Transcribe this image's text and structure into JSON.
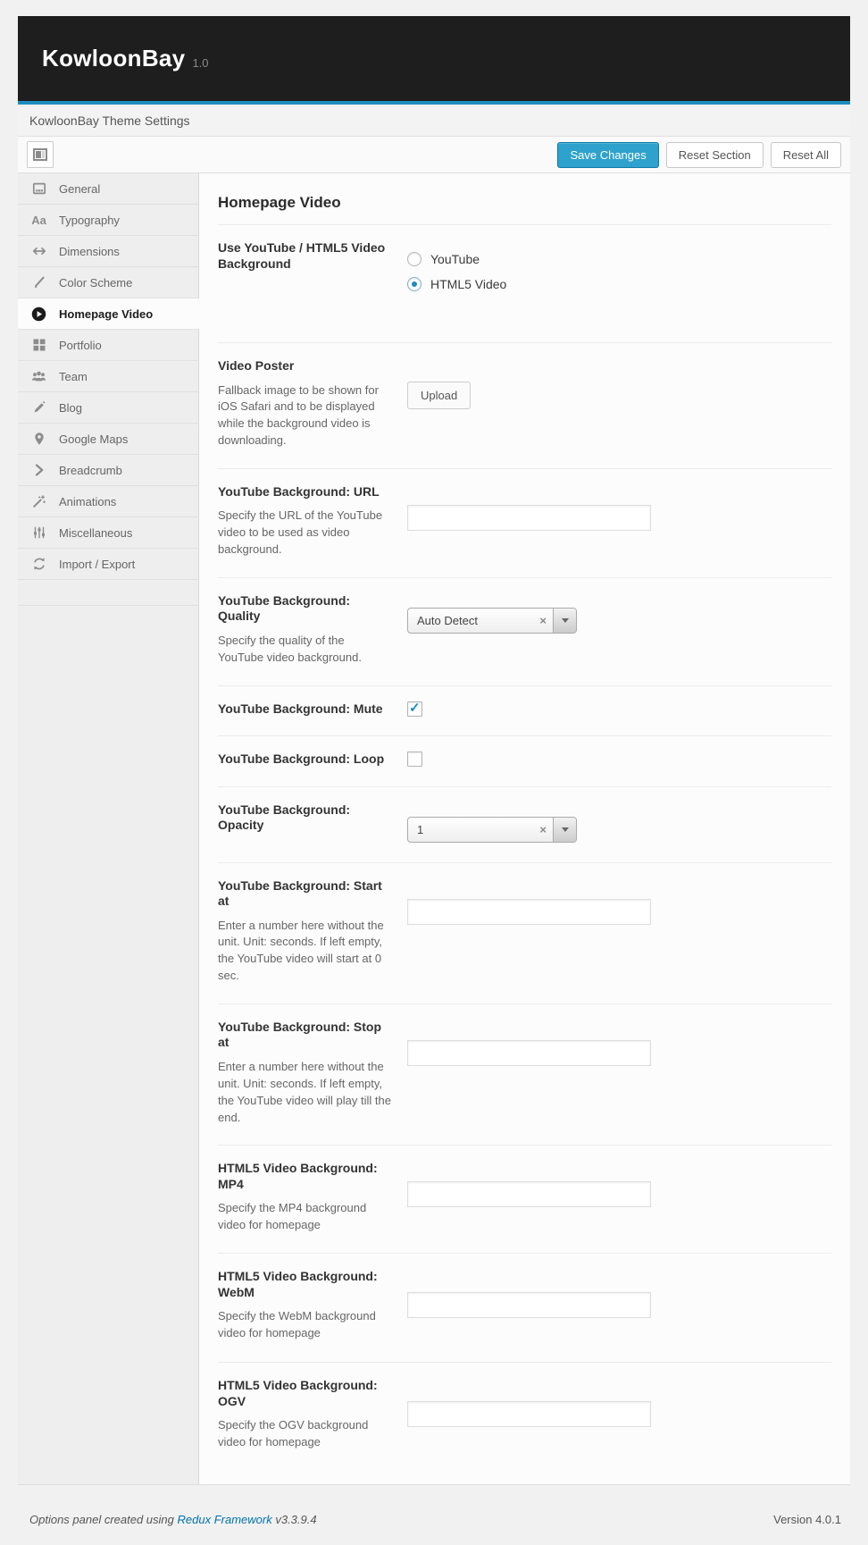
{
  "header": {
    "title": "KowloonBay",
    "version": "1.0"
  },
  "subheader": {
    "title": "KowloonBay Theme Settings"
  },
  "toolbar": {
    "save_label": "Save Changes",
    "reset_section_label": "Reset Section",
    "reset_all_label": "Reset All"
  },
  "sidebar": {
    "items": [
      {
        "label": "General",
        "icon": "screen-icon",
        "active": false
      },
      {
        "label": "Typography",
        "icon": "typography-icon",
        "active": false
      },
      {
        "label": "Dimensions",
        "icon": "arrows-horizontal-icon",
        "active": false
      },
      {
        "label": "Color Scheme",
        "icon": "pencil-stroke-icon",
        "active": false
      },
      {
        "label": "Homepage Video",
        "icon": "play-circle-icon",
        "active": true
      },
      {
        "label": "Portfolio",
        "icon": "grid-icon",
        "active": false
      },
      {
        "label": "Team",
        "icon": "people-icon",
        "active": false
      },
      {
        "label": "Blog",
        "icon": "pencil-icon",
        "active": false
      },
      {
        "label": "Google Maps",
        "icon": "map-pin-icon",
        "active": false
      },
      {
        "label": "Breadcrumb",
        "icon": "chevron-right-icon",
        "active": false
      },
      {
        "label": "Animations",
        "icon": "magic-wand-icon",
        "active": false
      },
      {
        "label": "Miscellaneous",
        "icon": "sliders-icon",
        "active": false
      },
      {
        "label": "Import / Export",
        "icon": "sync-icon",
        "active": false
      }
    ]
  },
  "page": {
    "title": "Homepage Video",
    "fields": {
      "video_bg_type": {
        "label": "Use YouTube / HTML5 Video Background",
        "options": [
          {
            "label": "YouTube",
            "selected": false
          },
          {
            "label": "HTML5 Video",
            "selected": true
          }
        ]
      },
      "video_poster": {
        "label": "Video Poster",
        "desc": "Fallback image to be shown for iOS Safari and to be displayed while the background video is downloading.",
        "button_label": "Upload"
      },
      "yt_url": {
        "label": "YouTube Background: URL",
        "desc": "Specify the URL of the YouTube video to be used as video background.",
        "value": ""
      },
      "yt_quality": {
        "label": "YouTube Background: Quality",
        "desc": "Specify the quality of the YouTube video background.",
        "value": "Auto Detect"
      },
      "yt_mute": {
        "label": "YouTube Background: Mute",
        "checked": true
      },
      "yt_loop": {
        "label": "YouTube Background: Loop",
        "checked": false
      },
      "yt_opacity": {
        "label": "YouTube Background: Opacity",
        "value": "1"
      },
      "yt_start": {
        "label": "YouTube Background: Start at",
        "desc": "Enter a number here without the unit. Unit: seconds. If left empty, the YouTube video will start at 0 sec.",
        "value": ""
      },
      "yt_stop": {
        "label": "YouTube Background: Stop at",
        "desc": "Enter a number here without the unit. Unit: seconds. If left empty, the YouTube video will play till the end.",
        "value": ""
      },
      "html5_mp4": {
        "label": "HTML5 Video Background: MP4",
        "desc": "Specify the MP4 background video for homepage",
        "value": ""
      },
      "html5_webm": {
        "label": "HTML5 Video Background: WebM",
        "desc": "Specify the WebM background video for homepage",
        "value": ""
      },
      "html5_ogv": {
        "label": "HTML5 Video Background: OGV",
        "desc": "Specify the OGV background video for homepage",
        "value": ""
      }
    }
  },
  "footer": {
    "left_prefix": "Options panel created using",
    "link_label": "Redux Framework",
    "left_suffix": "v3.3.9.4",
    "version": "Version 4.0.1"
  },
  "colors": {
    "accent_blue": "#2ea2cc",
    "header_line_blue": "#1e8cbe",
    "check_blue": "#1e8cbe",
    "banner_bg": "#1e1e1e"
  }
}
